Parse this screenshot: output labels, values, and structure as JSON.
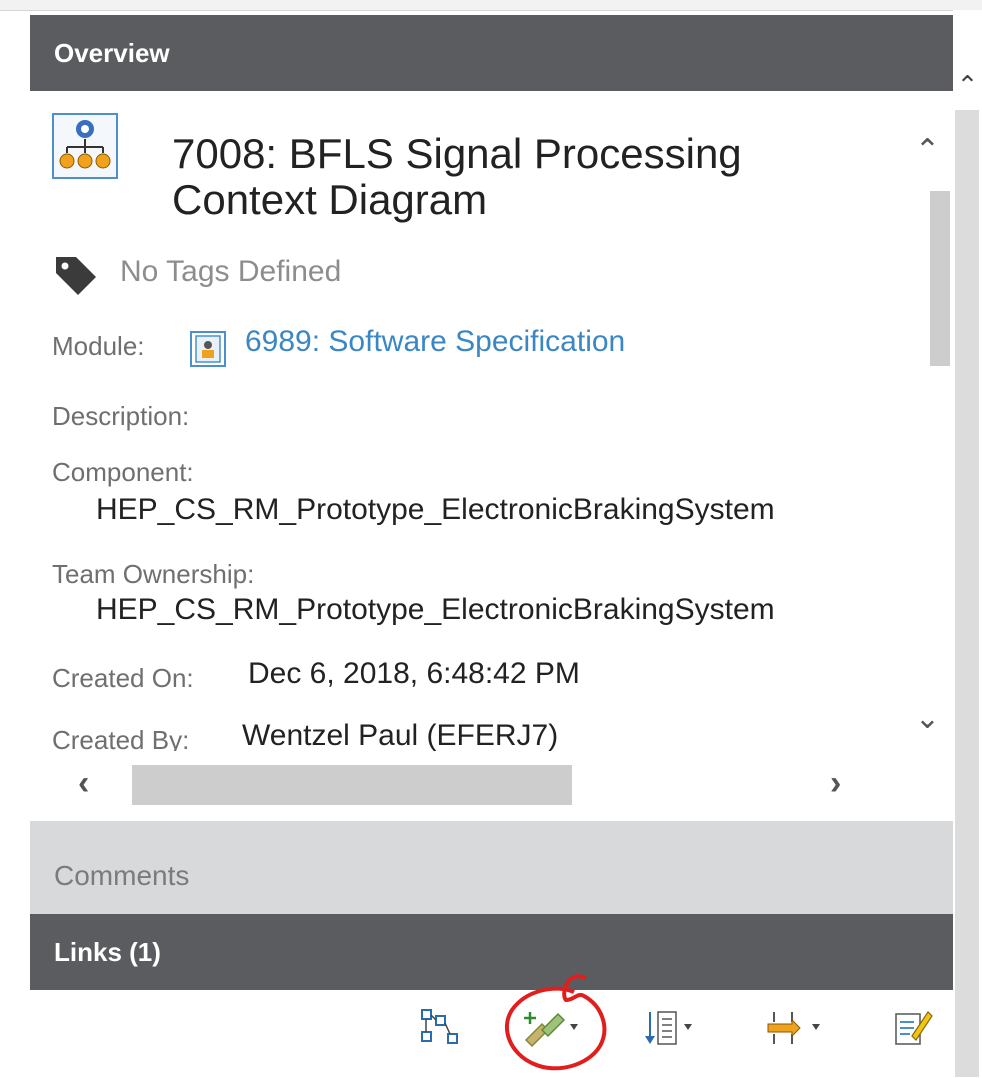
{
  "overview": {
    "header": "Overview",
    "artifact_icon": "diagram-icon",
    "title": "7008: BFLS Signal Processing Context Diagram",
    "tags_icon": "tag-icon",
    "tags_text": "No Tags Defined",
    "module_label": "Module:",
    "module_icon": "module-icon",
    "module_link": "6989: Software Specification",
    "description_label": "Description:",
    "component_label": "Component:",
    "component_value": "HEP_CS_RM_Prototype_ElectronicBrakingSystem",
    "team_label": "Team Ownership:",
    "team_value": "HEP_CS_RM_Prototype_ElectronicBrakingSystem",
    "created_on_label": "Created On:",
    "created_on_value": "Dec 6, 2018, 6:48:42 PM",
    "created_by_label": "Created By:",
    "created_by_value": "Wentzel Paul (EFERJ7)"
  },
  "comments": {
    "header": "Comments"
  },
  "links": {
    "header": "Links (1)",
    "toolbar": [
      {
        "icon": "link-graph-icon"
      },
      {
        "icon": "add-link-icon",
        "dropdown": true,
        "highlighted": true
      },
      {
        "icon": "sort-list-icon",
        "dropdown": true
      },
      {
        "icon": "filter-links-icon",
        "dropdown": true
      },
      {
        "icon": "edit-note-icon"
      }
    ]
  },
  "colors": {
    "header_bg": "#5a5c60",
    "collapsed_header_bg": "#d8d9db",
    "link": "#3b87c4",
    "annotation_red": "#e01e1e"
  }
}
